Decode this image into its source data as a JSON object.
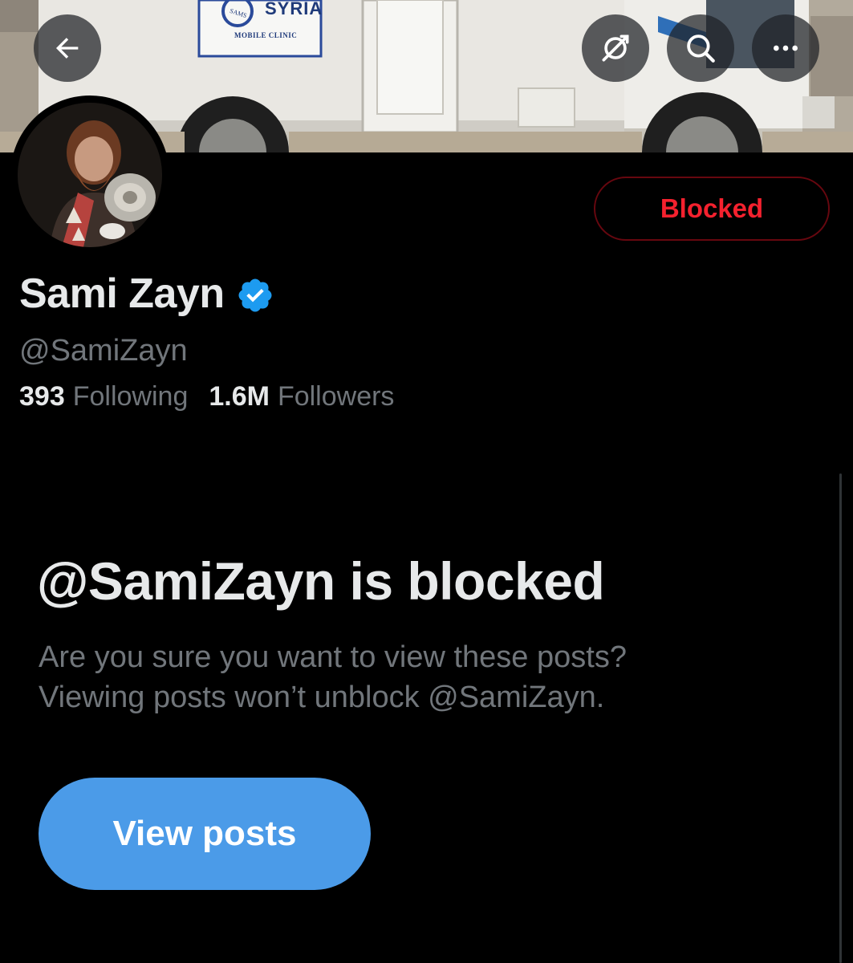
{
  "banner": {
    "sign_title": "SYRIA",
    "sign_subtitle": "MOBILE CLINIC",
    "sign_logo_text": "SAMS"
  },
  "header": {
    "back_icon": "arrow-left-icon",
    "ban_icon": "grok-slash-icon",
    "search_icon": "search-icon",
    "more_icon": "more-horizontal-icon"
  },
  "profile": {
    "display_name": "Sami Zayn",
    "handle": "@SamiZayn",
    "verified": true,
    "following_count": "393",
    "following_label": "Following",
    "followers_count": "1.6M",
    "followers_label": "Followers",
    "blocked_button_label": "Blocked"
  },
  "blocked_notice": {
    "title": "@SamiZayn is blocked",
    "description_line1": "Are you sure you want to view these posts?",
    "description_line2": "Viewing posts won’t unblock @SamiZayn.",
    "view_posts_label": "View posts"
  },
  "colors": {
    "background": "#000000",
    "primary_text": "#e7e9ea",
    "secondary_text": "#71767b",
    "blocked_red": "#f4212e",
    "blocked_border": "#67070f",
    "accent_blue": "#4b9be8",
    "verified_blue": "#1d9bf0"
  }
}
